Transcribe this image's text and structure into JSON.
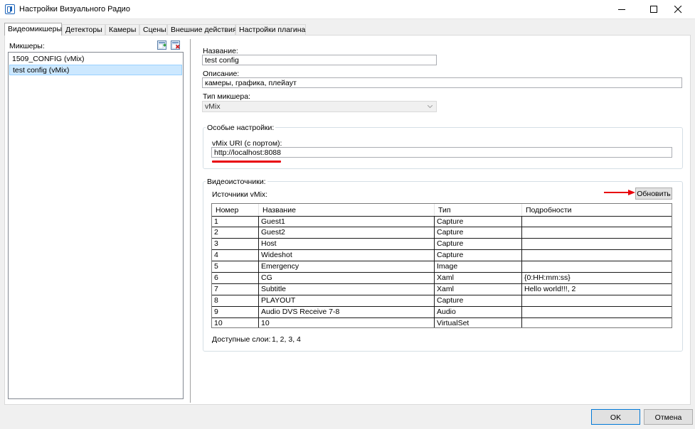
{
  "window": {
    "title": "Настройки Визуального Радио"
  },
  "tabs": [
    {
      "label": "Видеомикшеры",
      "active": true
    },
    {
      "label": "Детекторы"
    },
    {
      "label": "Камеры"
    },
    {
      "label": "Сцены"
    },
    {
      "label": "Внешние действия"
    },
    {
      "label": "Настройки плагина"
    }
  ],
  "mixers": {
    "label": "Микшеры:",
    "items": [
      {
        "label": "1509_CONFIG (vMix)"
      },
      {
        "label": "test config (vMix)",
        "selected": true
      }
    ]
  },
  "form": {
    "name_label": "Название:",
    "name_value": "test config",
    "description_label": "Описание:",
    "description_value": "камеры, графика, плейаут",
    "type_label": "Тип микшера:",
    "type_value": "vMix"
  },
  "special": {
    "title": "Особые настройки:",
    "uri_label": "vMix URI (с портом):",
    "uri_value": "http://localhost:8088"
  },
  "sources": {
    "title": "Видеоисточники:",
    "list_label": "Источники vMix:",
    "refresh_label": "Обновить",
    "columns": [
      "Номер",
      "Название",
      "Тип",
      "Подробности"
    ],
    "rows": [
      [
        "1",
        "Guest1",
        "Capture",
        ""
      ],
      [
        "2",
        "Guest2",
        "Capture",
        ""
      ],
      [
        "3",
        "Host",
        "Capture",
        ""
      ],
      [
        "4",
        "Wideshot",
        "Capture",
        ""
      ],
      [
        "5",
        "Emergency",
        "Image",
        ""
      ],
      [
        "6",
        "CG",
        "Xaml",
        "{0:HH:mm:ss}"
      ],
      [
        "7",
        "Subtitle",
        "Xaml",
        "Hello world!!!, 2"
      ],
      [
        "8",
        "PLAYOUT",
        "Capture",
        ""
      ],
      [
        "9",
        "Audio DVS Receive  7-8",
        "Audio",
        ""
      ],
      [
        "10",
        "10",
        "VirtualSet",
        ""
      ]
    ],
    "layers_label": "Доступные слои:",
    "layers_value": "1, 2, 3, 4"
  },
  "buttons": {
    "ok": "OK",
    "cancel": "Отмена"
  },
  "colors": {
    "selection": "#cce8ff",
    "annotation": "#e8000b",
    "accent": "#0078d7"
  },
  "icons": [
    "app-icon",
    "add-mixer-icon",
    "delete-mixer-icon",
    "chevron-down-icon",
    "arrow-right-icon"
  ]
}
